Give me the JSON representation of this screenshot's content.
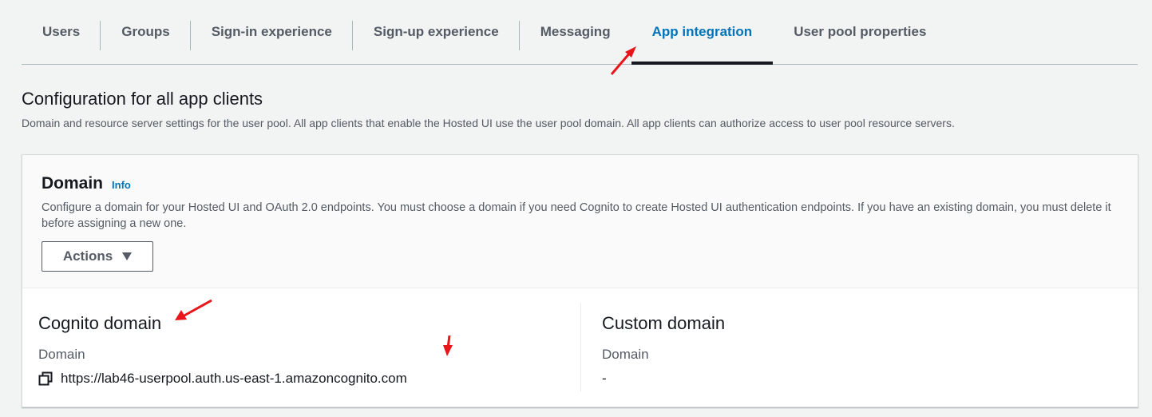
{
  "tabs": [
    {
      "label": "Users",
      "active": false
    },
    {
      "label": "Groups",
      "active": false
    },
    {
      "label": "Sign-in experience",
      "active": false
    },
    {
      "label": "Sign-up experience",
      "active": false
    },
    {
      "label": "Messaging",
      "active": false
    },
    {
      "label": "App integration",
      "active": true
    },
    {
      "label": "User pool properties",
      "active": false
    }
  ],
  "section": {
    "title": "Configuration for all app clients",
    "description": "Domain and resource server settings for the user pool. All app clients that enable the Hosted UI use the user pool domain. All app clients can authorize access to user pool resource servers."
  },
  "domain_panel": {
    "title": "Domain",
    "info_label": "Info",
    "description": "Configure a domain for your Hosted UI and OAuth 2.0 endpoints. You must choose a domain if you need Cognito to create Hosted UI authentication endpoints. If you have an existing domain, you must delete it before assigning a new one.",
    "actions_label": "Actions"
  },
  "cognito_domain": {
    "title": "Cognito domain",
    "field_label": "Domain",
    "value": "https://lab46-userpool.auth.us-east-1.amazoncognito.com"
  },
  "custom_domain": {
    "title": "Custom domain",
    "field_label": "Domain",
    "value": "-"
  },
  "colors": {
    "accent": "#0073bb",
    "annotation_arrow": "#e8161b"
  },
  "icons": {
    "copy": "copy-icon",
    "actions_caret": "caret-down-icon"
  }
}
